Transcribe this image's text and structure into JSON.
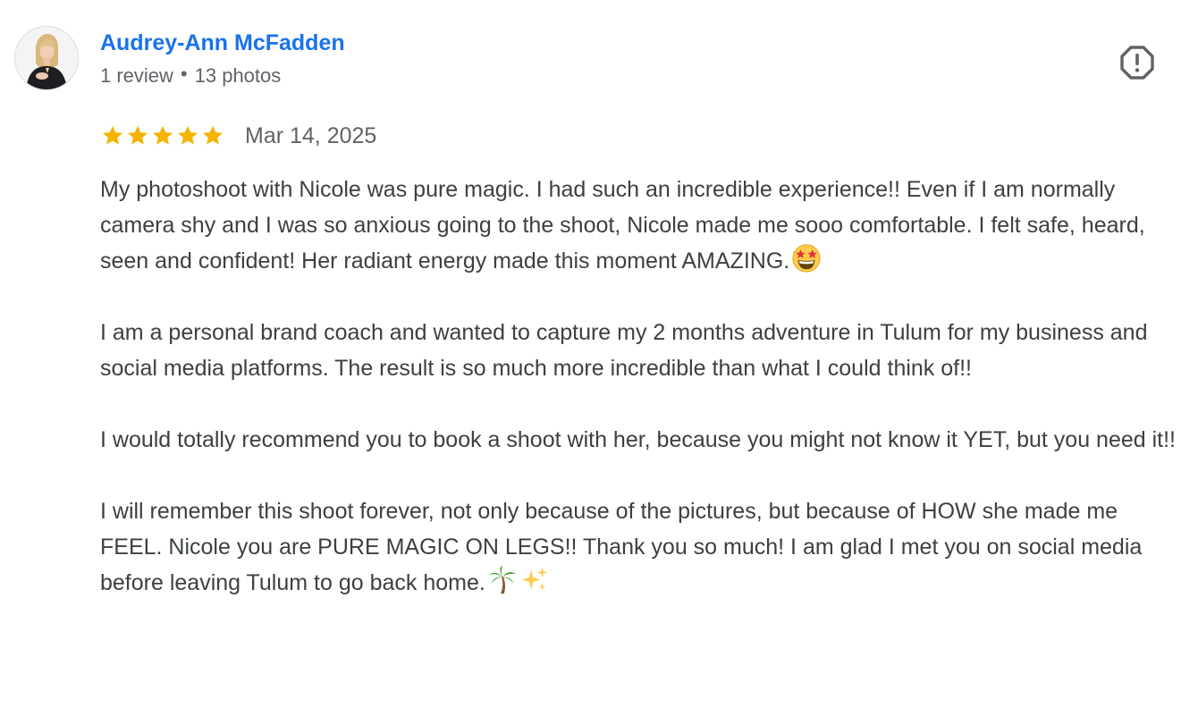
{
  "reviewer": {
    "name": "Audrey-Ann McFadden",
    "reviews": "1 review",
    "separator": "•",
    "photos": "13 photos",
    "avatar_icon": "profile-photo"
  },
  "actions": {
    "flag_icon": "report-flag-icon"
  },
  "rating": {
    "stars": 5,
    "max_stars": 5,
    "star_color": "#f4b400",
    "date": "Mar 14, 2025"
  },
  "body": {
    "p1": "My photoshoot with Nicole was pure magic. I had such an incredible experience!! Even if I am normally camera shy and I was so anxious going to the shoot, Nicole made me sooo comfortable. I felt safe, heard, seen and confident! Her radiant energy made this moment AMAZING.",
    "p1_emoji": "star-struck-emoji",
    "p2": "I am a personal brand coach and wanted to capture my 2 months adventure in Tulum for my business and social media platforms. The result is so much more incredible than what I could think of!!",
    "p3": "I would totally recommend you to book a shoot with her, because you might not know it YET, but you need it!!",
    "p4": "I will remember this shoot forever, not only because of the pictures, but because of HOW she made me FEEL. Nicole you are PURE MAGIC ON LEGS!! Thank you so much! I am glad I met you on social media before leaving Tulum to go back home.",
    "p4_emojis": [
      "palm-tree-emoji",
      "sparkles-emoji"
    ]
  },
  "colors": {
    "link": "#1a73e8",
    "text": "#3c4043",
    "muted": "#5f6368"
  }
}
